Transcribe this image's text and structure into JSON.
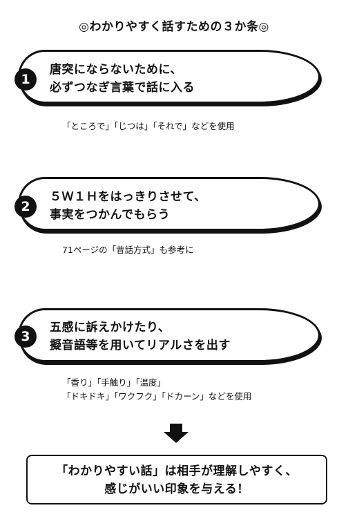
{
  "title": "◎わかりやすく話すための３か条◎",
  "items": [
    {
      "number": "1",
      "lines": [
        "唐突にならないために、",
        "必ずつなぎ言葉で話に入る"
      ],
      "notes": [
        "「ところで」「じつは」「それで」などを使用"
      ]
    },
    {
      "number": "2",
      "lines": [
        "５Ｗ１Ｈをはっきりさせて、",
        "事実をつかんでもらう"
      ],
      "notes": [
        "71ページの「昔話方式」も参考に"
      ]
    },
    {
      "number": "3",
      "lines": [
        "五感に訴えかけたり、",
        "擬音語等を用いてリアルさを出す"
      ],
      "notes": [
        "「香り」「手触り」「温度」",
        "「ドキドキ」「ワクフク」「ドカーン」などを使用"
      ]
    }
  ],
  "summary": {
    "line1": "「わかりやすい話」は相手が理解しやすく、",
    "line2": "感じがいい印象を与える！"
  },
  "icons": {
    "arrow": "down-arrow-icon"
  },
  "colors": {
    "ink": "#111111",
    "background": "#ffffff"
  }
}
